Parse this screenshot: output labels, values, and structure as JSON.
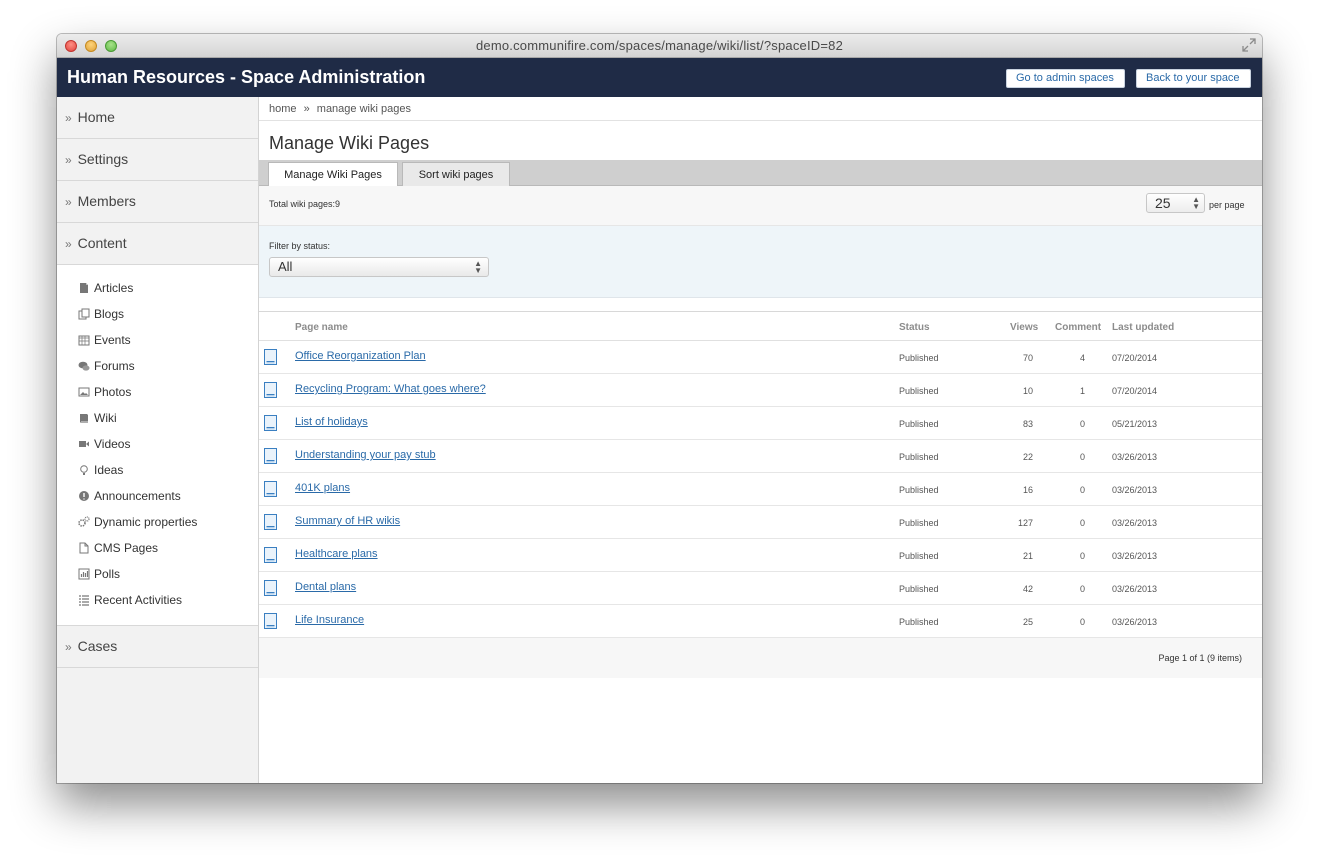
{
  "window": {
    "url": "demo.communifire.com/spaces/manage/wiki/list/?spaceID=82"
  },
  "header": {
    "title": "Human Resources - Space Administration",
    "admin_spaces_label": "Go to admin spaces",
    "back_label": "Back to your space"
  },
  "sidebar": {
    "sections": [
      {
        "label": "Home"
      },
      {
        "label": "Settings"
      },
      {
        "label": "Members"
      },
      {
        "label": "Content"
      }
    ],
    "content_items": [
      {
        "label": "Articles",
        "icon": "article-icon"
      },
      {
        "label": "Blogs",
        "icon": "blog-icon"
      },
      {
        "label": "Events",
        "icon": "calendar-icon"
      },
      {
        "label": "Forums",
        "icon": "forum-icon"
      },
      {
        "label": "Photos",
        "icon": "photo-icon"
      },
      {
        "label": "Wiki",
        "icon": "wiki-icon"
      },
      {
        "label": "Videos",
        "icon": "video-icon"
      },
      {
        "label": "Ideas",
        "icon": "lightbulb-icon"
      },
      {
        "label": "Announcements",
        "icon": "info-icon"
      },
      {
        "label": "Dynamic properties",
        "icon": "gears-icon"
      },
      {
        "label": "CMS Pages",
        "icon": "page-icon"
      },
      {
        "label": "Polls",
        "icon": "poll-chart-icon"
      },
      {
        "label": "Recent Activities",
        "icon": "list-icon"
      }
    ],
    "cases_label": "Cases"
  },
  "breadcrumb": {
    "home": "home",
    "separator": "»",
    "current": "manage wiki pages"
  },
  "page_title": "Manage Wiki Pages",
  "tabs": {
    "active": "Manage Wiki Pages",
    "inactive": "Sort wiki pages"
  },
  "totals": {
    "text": "Total wiki pages:9",
    "per_page_value": "25",
    "per_page_label": "per page"
  },
  "filter": {
    "label": "Filter by status:",
    "selected": "All"
  },
  "table": {
    "columns": [
      "Page name",
      "Status",
      "Views",
      "Comment",
      "Last updated"
    ],
    "rows": [
      {
        "name": "Office Reorganization Plan",
        "status": "Published",
        "views": "70",
        "comments": "4",
        "updated": "07/20/2014"
      },
      {
        "name": "Recycling Program: What goes where?",
        "status": "Published",
        "views": "10",
        "comments": "1",
        "updated": "07/20/2014"
      },
      {
        "name": "List of holidays",
        "status": "Published",
        "views": "83",
        "comments": "0",
        "updated": "05/21/2013"
      },
      {
        "name": "Understanding your pay stub",
        "status": "Published",
        "views": "22",
        "comments": "0",
        "updated": "03/26/2013"
      },
      {
        "name": "401K plans",
        "status": "Published",
        "views": "16",
        "comments": "0",
        "updated": "03/26/2013"
      },
      {
        "name": "Summary of HR wikis",
        "status": "Published",
        "views": "127",
        "comments": "0",
        "updated": "03/26/2013"
      },
      {
        "name": "Healthcare plans",
        "status": "Published",
        "views": "21",
        "comments": "0",
        "updated": "03/26/2013"
      },
      {
        "name": "Dental plans",
        "status": "Published",
        "views": "42",
        "comments": "0",
        "updated": "03/26/2013"
      },
      {
        "name": "Life Insurance",
        "status": "Published",
        "views": "25",
        "comments": "0",
        "updated": "03/26/2013"
      }
    ]
  },
  "pager": {
    "text": "Page 1 of 1 (9 items)"
  },
  "colors": {
    "header_bg": "#1f2b46",
    "link": "#2a6aa8",
    "filter_bg": "#eef5f9"
  }
}
